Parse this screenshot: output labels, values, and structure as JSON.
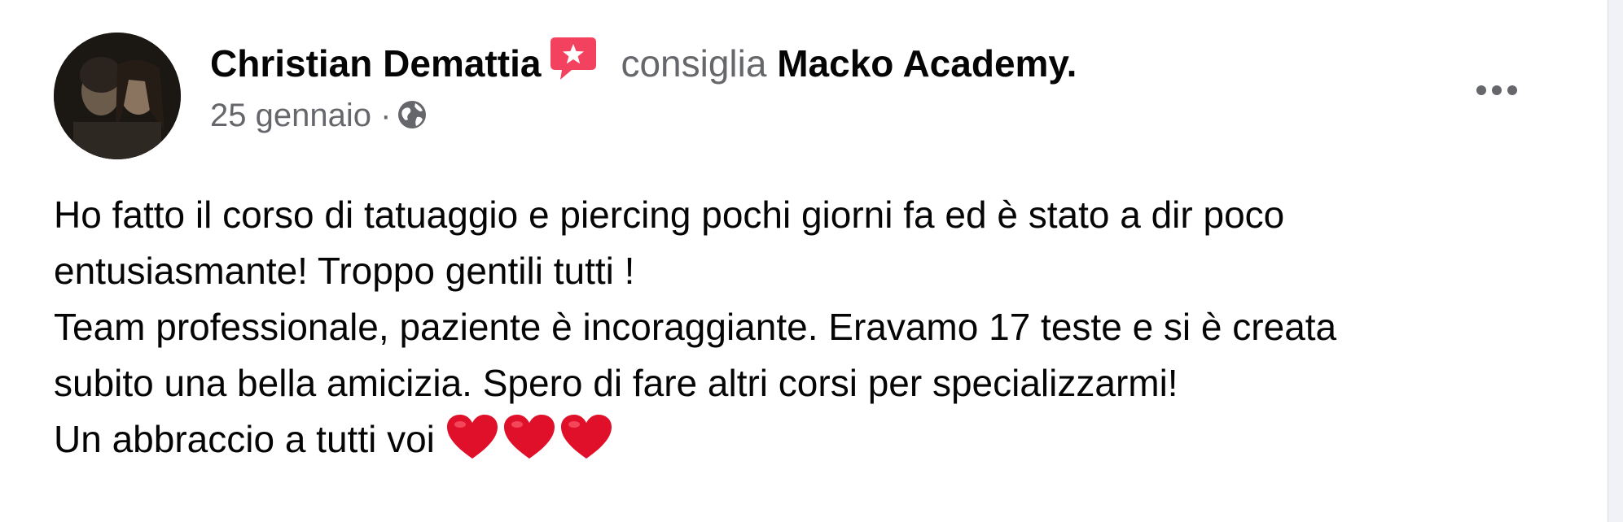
{
  "post": {
    "author": "Christian Demattia",
    "action": "consiglia",
    "page_name": "Macko Academy.",
    "date": "25 gennaio",
    "separator": "·",
    "privacy_icon": "globe-icon",
    "more_icon": "more-options-icon",
    "badge_icon": "recommendation-badge-icon",
    "text_lines": [
      "Ho fatto il corso di tatuaggio e piercing pochi giorni fa ed è stato a dir poco",
      "entusiasmante! Troppo gentili tutti !",
      "Team professionale, paziente è incoraggiante. Eravamo 17 teste e si è creata",
      "subito una bella amicizia. Spero di fare altri corsi per specializzarmi!",
      "Un abbraccio a tutti voi"
    ],
    "hearts": [
      "❤",
      "❤",
      "❤"
    ]
  },
  "colors": {
    "text_primary": "#050505",
    "text_secondary": "#65676b",
    "badge": "#f3425f",
    "heart": "#e0102a"
  }
}
